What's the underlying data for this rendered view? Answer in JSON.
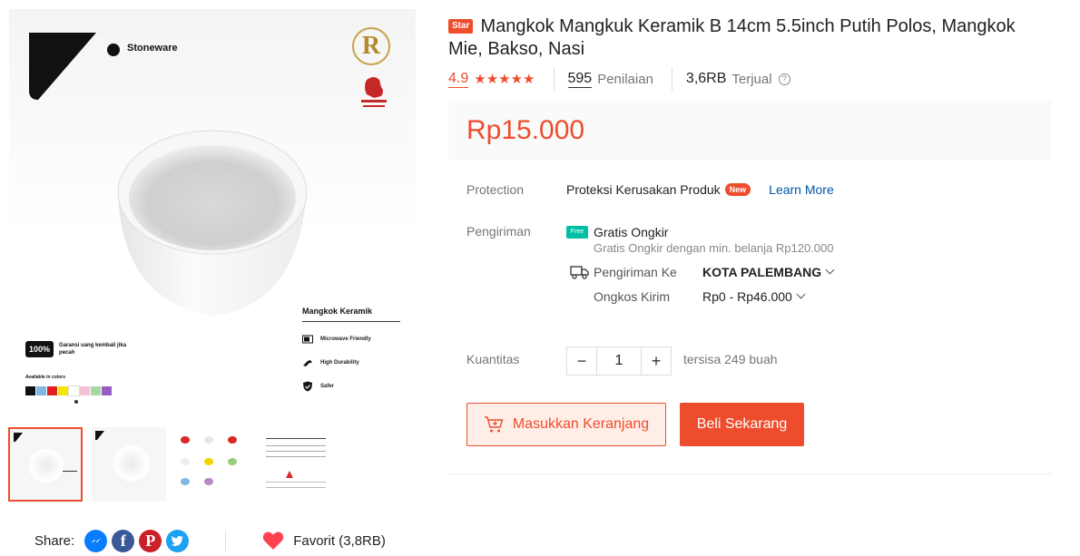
{
  "main_image": {
    "brand_text": "Stoneware",
    "logo_letter": "R",
    "spec_title": "Mangkok Keramik",
    "features": [
      "Microwave Friendly",
      "High Durability",
      "Safer"
    ],
    "guarantee_badge": "100%",
    "guarantee_text": "Garansi uang kembali jika pecah",
    "available_label": "Available in colors",
    "colors": [
      "#111111",
      "#7fb8e6",
      "#e02020",
      "#f5e400",
      "#ffffff",
      "#f2c2d8",
      "#a8d8a0",
      "#9a5cc4"
    ]
  },
  "thumbnails": [
    "thumb-1",
    "thumb-2",
    "thumb-3",
    "thumb-4"
  ],
  "share": {
    "label": "Share:",
    "favorite_label": "Favorit (3,8RB)"
  },
  "product": {
    "badge": "Star",
    "title": "Mangkok Mangkuk Keramik B 14cm 5.5inch Putih Polos, Mangkok Mie, Bakso, Nasi",
    "rating": "4.9",
    "stars": 5,
    "review_count": "595",
    "review_label": "Penilaian",
    "sold_count": "3,6RB",
    "sold_label": "Terjual",
    "price": "Rp15.000"
  },
  "protection": {
    "label": "Protection",
    "value": "Proteksi Kerusakan Produk",
    "new_badge": "New",
    "link": "Learn More"
  },
  "shipping": {
    "label": "Pengiriman",
    "free_icon_text": "Free",
    "free_title": "Gratis Ongkir",
    "free_sub": "Gratis Ongkir dengan min. belanja Rp120.000",
    "to_label": "Pengiriman Ke",
    "to_value": "KOTA PALEMBANG",
    "cost_label": "Ongkos Kirim",
    "cost_value": "Rp0 - Rp46.000"
  },
  "quantity": {
    "label": "Kuantitas",
    "minus": "−",
    "value": "1",
    "plus": "+",
    "stock": "tersisa 249 buah"
  },
  "actions": {
    "add_to_cart": "Masukkan Keranjang",
    "buy_now": "Beli Sekarang"
  },
  "accent_color": "#ee4d2d"
}
